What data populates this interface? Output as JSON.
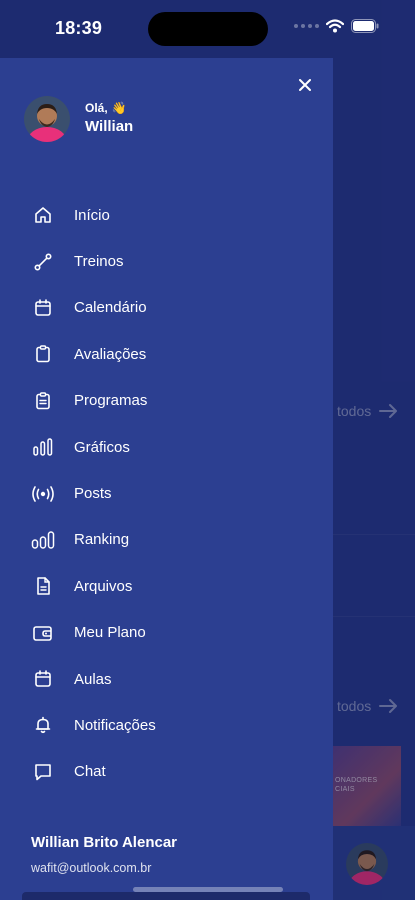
{
  "status_bar": {
    "time": "18:39"
  },
  "drawer": {
    "greeting": "Olá,",
    "greeting_emoji": "👋",
    "user_first_name": "Willian",
    "menu": [
      {
        "label": "Início",
        "icon": "home-icon"
      },
      {
        "label": "Treinos",
        "icon": "dumbbell-icon"
      },
      {
        "label": "Calendário",
        "icon": "calendar-icon"
      },
      {
        "label": "Avaliações",
        "icon": "clipboard-icon"
      },
      {
        "label": "Programas",
        "icon": "clipboard-list-icon"
      },
      {
        "label": "Gráficos",
        "icon": "bar-chart-icon"
      },
      {
        "label": "Posts",
        "icon": "broadcast-icon"
      },
      {
        "label": "Ranking",
        "icon": "ranking-icon"
      },
      {
        "label": "Arquivos",
        "icon": "file-icon"
      },
      {
        "label": "Meu Plano",
        "icon": "wallet-icon"
      },
      {
        "label": "Aulas",
        "icon": "calendar-icon"
      },
      {
        "label": "Notificações",
        "icon": "bell-icon"
      },
      {
        "label": "Chat",
        "icon": "chat-icon"
      }
    ],
    "account": {
      "full_name": "Willian Brito Alencar",
      "email": "wafit@outlook.com.br"
    }
  },
  "background": {
    "see_all_1": "todos",
    "see_all_2": "todos",
    "card_text": "ONADORES\nCIAIS"
  },
  "colors": {
    "drawer_bg": "#2c3f91",
    "app_bg": "#27378a",
    "avatar_shirt": "#e8307a"
  }
}
